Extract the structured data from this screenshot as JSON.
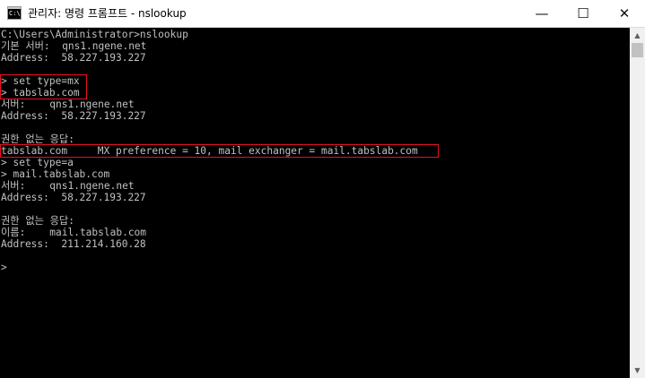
{
  "window": {
    "title": "관리자: 명령 프롬프트 - nslookup",
    "icon_label": "C:\\",
    "min_glyph": "—",
    "max_glyph": "☐",
    "close_glyph": "✕"
  },
  "console": {
    "lines": [
      "C:\\Users\\Administrator>nslookup",
      "기본 서버:  qns1.ngene.net",
      "Address:  58.227.193.227",
      "",
      "> set type=mx",
      "> tabslab.com",
      "서버:    qns1.ngene.net",
      "Address:  58.227.193.227",
      "",
      "권한 없는 응답:",
      "tabslab.com     MX preference = 10, mail exchanger = mail.tabslab.com",
      "> set type=a",
      "> mail.tabslab.com",
      "서버:    qns1.ngene.net",
      "Address:  58.227.193.227",
      "",
      "권한 없는 응답:",
      "이름:    mail.tabslab.com",
      "Address:  211.214.160.28",
      "",
      ">"
    ]
  },
  "scrollbar": {
    "up_glyph": "▲",
    "down_glyph": "▼"
  },
  "colors": {
    "console_bg": "#000000",
    "console_text": "#c0c0c0",
    "highlight_border": "#e81123",
    "titlebar_bg": "#ffffff"
  }
}
